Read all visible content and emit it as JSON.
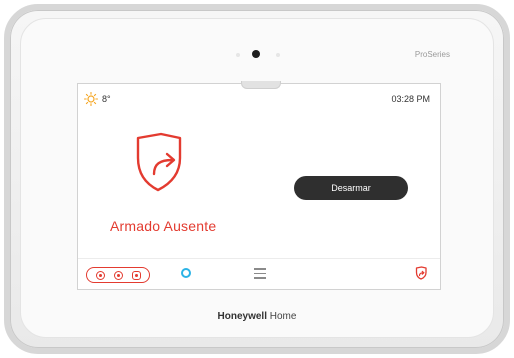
{
  "device": {
    "brand_top": "ProSeries",
    "brand_bottom_bold": "Honeywell",
    "brand_bottom_rest": " Home"
  },
  "status_bar": {
    "weather_icon": "sun-icon",
    "temperature": "8°",
    "time": "03:28 PM"
  },
  "main": {
    "status_icon": "shield-arm-away-icon",
    "status_label": "Armado Ausente",
    "disarm_button_label": "Desarmar"
  },
  "bottom_bar": {
    "icons": [
      "sensor-status-icon",
      "alexa-icon",
      "menu-icon",
      "arm-mode-icon"
    ]
  },
  "colors": {
    "accent_red": "#e33b30",
    "button_dark": "#2f2f2f",
    "alexa_blue": "#2bb3e6",
    "sun_orange": "#f5a623"
  }
}
